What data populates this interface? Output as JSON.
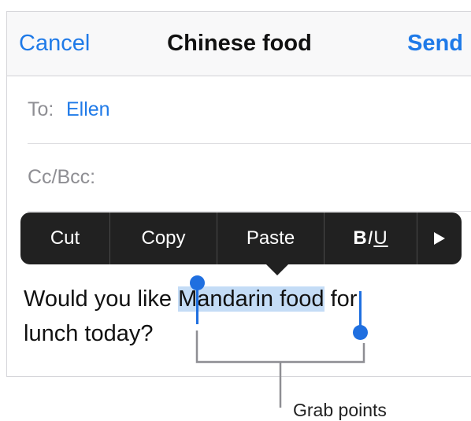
{
  "nav": {
    "cancel_label": "Cancel",
    "title": "Chinese food",
    "send_label": "Send"
  },
  "fields": {
    "to_label": "To:",
    "to_value": "Ellen",
    "cc_label": "Cc/Bcc:"
  },
  "edit_menu": {
    "cut": "Cut",
    "copy": "Copy",
    "paste": "Paste",
    "format_b": "B",
    "format_i": "I",
    "format_u": "U",
    "more_icon": "triangle-right-icon"
  },
  "body": {
    "before_selection": "Would you like ",
    "selected_text": "Mandarin food",
    "after_selection_line1": " for",
    "line2": "lunch today?"
  },
  "callout": {
    "label": "Grab points"
  },
  "colors": {
    "accent": "#1f7ae8",
    "selection": "#c4dcf6",
    "handle": "#1f6fe0",
    "menu_bg": "#212121"
  }
}
